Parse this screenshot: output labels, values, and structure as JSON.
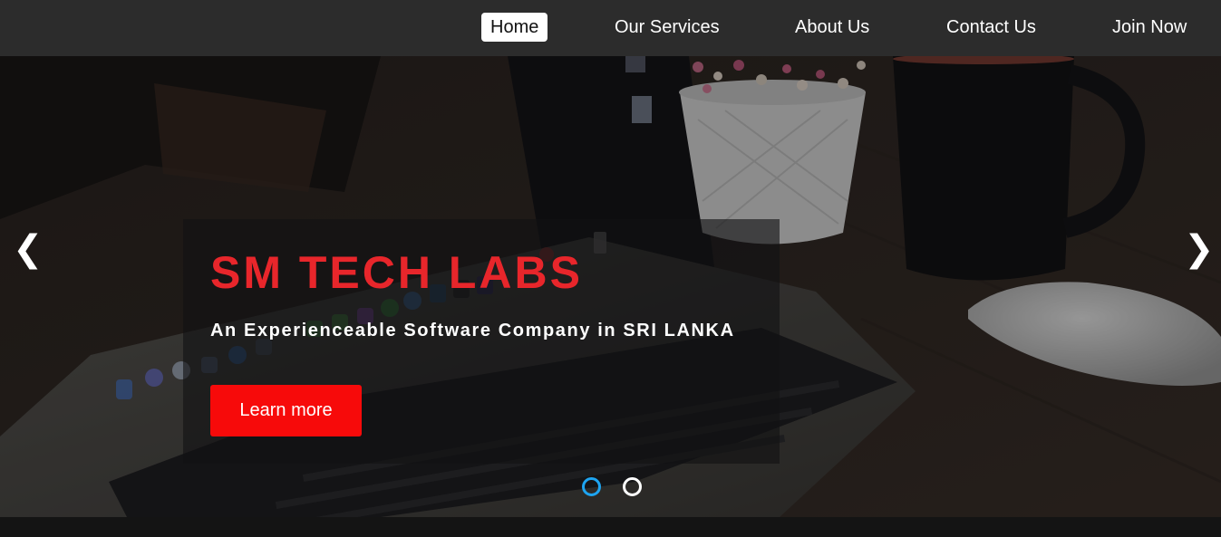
{
  "nav": {
    "items": [
      {
        "label": "Home",
        "active": true
      },
      {
        "label": "Our Services",
        "active": false
      },
      {
        "label": "About Us",
        "active": false
      },
      {
        "label": "Contact Us",
        "active": false
      },
      {
        "label": "Join Now",
        "active": false
      }
    ]
  },
  "hero": {
    "title": "SM TECH LABS",
    "subtitle": "An Experienceable Software Company in SRI LANKA",
    "cta_label": "Learn more",
    "prev_arrow": "❮",
    "next_arrow": "❯",
    "slides_count": 2,
    "active_slide": 1
  },
  "colors": {
    "nav_bg": "#2c2c2c",
    "title_red": "#e8262b",
    "button_red": "#f70a0a",
    "active_dot": "#1ea4f0"
  }
}
